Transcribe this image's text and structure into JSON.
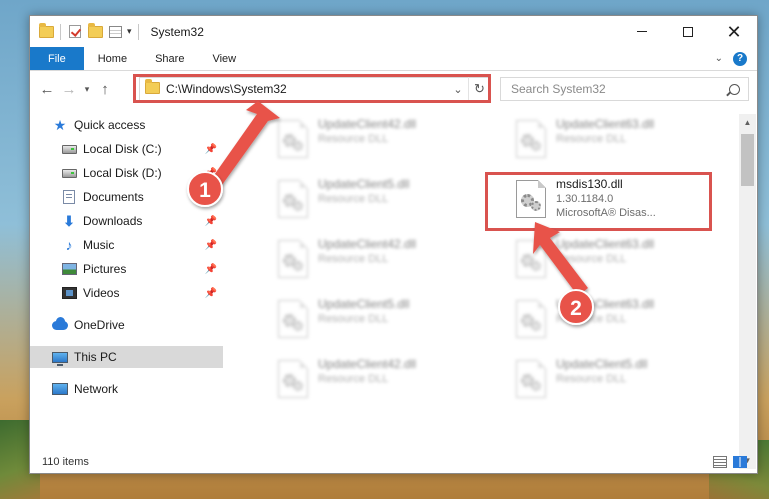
{
  "window": {
    "title": "System32"
  },
  "ribbon": {
    "tabs": [
      "File",
      "Home",
      "Share",
      "View"
    ],
    "help": "?"
  },
  "nav": {
    "address": "C:\\Windows\\System32",
    "search_placeholder": "Search System32"
  },
  "sidebar": {
    "items": [
      {
        "label": "Quick access",
        "icon": "star-icon"
      },
      {
        "label": "Local Disk (C:)",
        "icon": "disk-icon",
        "pinned": true
      },
      {
        "label": "Local Disk (D:)",
        "icon": "disk-icon",
        "pinned": true
      },
      {
        "label": "Documents",
        "icon": "documents-icon",
        "pinned": true
      },
      {
        "label": "Downloads",
        "icon": "downloads-icon",
        "pinned": true
      },
      {
        "label": "Music",
        "icon": "music-icon",
        "pinned": true
      },
      {
        "label": "Pictures",
        "icon": "pictures-icon",
        "pinned": true
      },
      {
        "label": "Videos",
        "icon": "videos-icon",
        "pinned": true
      },
      {
        "label": "OneDrive",
        "icon": "onedrive-icon"
      },
      {
        "label": "This PC",
        "icon": "this-pc-icon",
        "selected": true
      },
      {
        "label": "Network",
        "icon": "network-icon"
      }
    ]
  },
  "files": {
    "left": [
      {
        "name": "UpdateClient42.dll",
        "type": "Resource DLL"
      },
      {
        "name": "UpdateClient5.dll",
        "type": "Resource DLL"
      },
      {
        "name": "UpdateClient42.dll",
        "type": "Resource DLL"
      },
      {
        "name": "UpdateClient5.dll",
        "type": "Resource DLL"
      },
      {
        "name": "UpdateClient42.dll",
        "type": "Resource DLL"
      }
    ],
    "right": [
      {
        "name": "UpdateClient63.dll",
        "type": "Resource DLL"
      },
      {
        "name": "UpdateClient63.dll",
        "type": "Resource DLL"
      },
      {
        "name": "UpdateClient63.dll",
        "type": "Resource DLL"
      },
      {
        "name": "UpdateClient5.dll",
        "type": "Resource DLL"
      }
    ],
    "featured": {
      "name": "msdis130.dll",
      "version": "1.30.1184.0",
      "company": "MicrosoftA® Disas..."
    }
  },
  "status": {
    "item_count": "110 items"
  },
  "annotations": {
    "step1": "1",
    "step2": "2"
  },
  "colors": {
    "accent": "#1979ca",
    "highlight": "#d9534f"
  }
}
